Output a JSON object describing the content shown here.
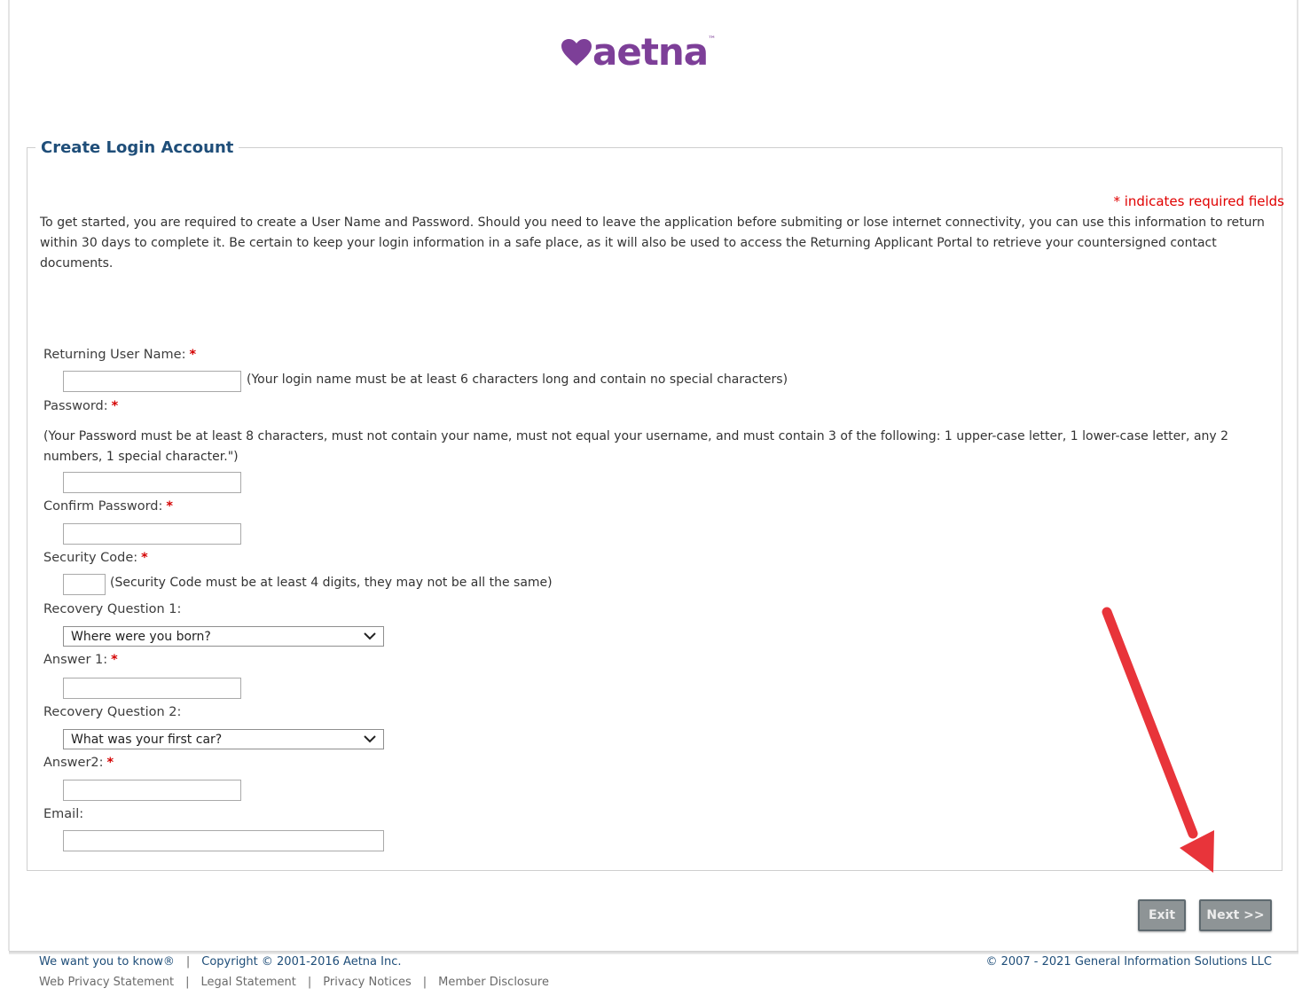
{
  "brand": {
    "name": "aetna",
    "color": "#7d3f98",
    "logo_icon": "heart-icon"
  },
  "form": {
    "title": "Create Login Account",
    "required_note": "* indicates required fields",
    "intro": "To get started, you are required to create a User Name and Password. Should you need to leave the application before submiting or lose internet connectivity, you can use this information to return within 30 days to complete it. Be certain to keep your login information in a safe place, as it will also be used to access the Returning Applicant Portal to retrieve your countersigned contact documents.",
    "required_marker": "*",
    "fields": {
      "username": {
        "label": "Returning User Name:",
        "hint": "(Your login name must be at least 6 characters long and contain no special characters)",
        "value": ""
      },
      "password": {
        "label": "Password:",
        "hint": "(Your Password must be at least 8 characters, must not contain your name, must not equal your username, and must contain 3 of the following: 1 upper-case letter, 1 lower-case letter, any 2 numbers, 1 special character.\")",
        "value": ""
      },
      "confirm_password": {
        "label": "Confirm Password:",
        "value": ""
      },
      "security_code": {
        "label": "Security Code:",
        "hint": "(Security Code must be at least 4 digits, they may not be all the same)",
        "value": ""
      },
      "recovery_question_1": {
        "label": "Recovery Question 1:",
        "selected": "Where were you born?"
      },
      "answer_1": {
        "label": "Answer 1:",
        "value": ""
      },
      "recovery_question_2": {
        "label": "Recovery Question 2:",
        "selected": "What was your first car?"
      },
      "answer_2": {
        "label": "Answer2:",
        "value": ""
      },
      "email": {
        "label": "Email:",
        "value": ""
      }
    }
  },
  "buttons": {
    "exit": "Exit",
    "next": "Next >>"
  },
  "annotation": {
    "arrow_color": "#e8343a"
  },
  "footer": {
    "links_row1": [
      "We want you to know®",
      "Copyright © 2001-2016 Aetna Inc."
    ],
    "links_row2": [
      "Web Privacy Statement",
      "Legal Statement",
      "Privacy Notices",
      "Member Disclosure"
    ],
    "vendor_copyright": "© 2007 - 2021 General Information Solutions LLC"
  }
}
